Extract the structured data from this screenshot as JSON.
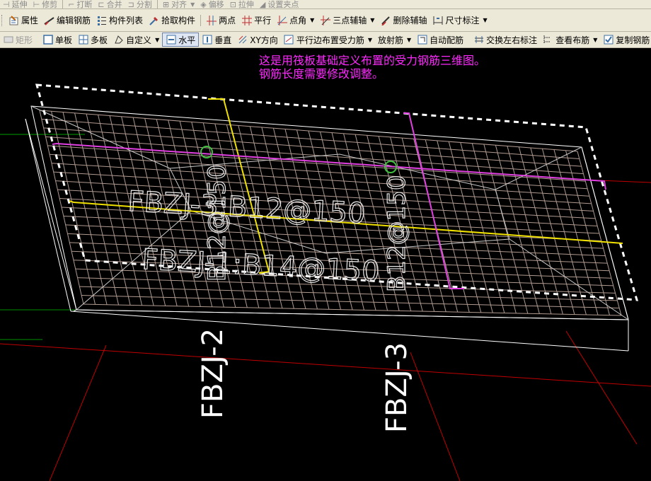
{
  "toolbar_top": {
    "items": [
      "延伸",
      "修剪",
      "打断",
      "合并",
      "分割",
      "对齐",
      "偏移",
      "拉伸",
      "设置夹点"
    ]
  },
  "toolbar1": {
    "properties": "属性",
    "edit_rebar": "编辑钢筋",
    "component_list": "构件列表",
    "pick_component": "拾取构件",
    "two_points": "两点",
    "parallel": "平行",
    "point_angle": "点角",
    "three_point_aux": "三点辅轴",
    "delete_aux": "删除辅轴",
    "dimension": "尺寸标注"
  },
  "toolbar2": {
    "rectangle": "矩形",
    "single_slab": "单板",
    "multi_slab": "多板",
    "custom": "自定义",
    "horizontal": "水平",
    "vertical": "垂直",
    "xy_direction": "XY方向",
    "parallel_edge_rebar": "平行边布置受力筋",
    "radial_rebar": "放射筋",
    "auto_rebar": "自动配筋",
    "swap_labels": "交换左右标注",
    "view_rebar": "查看布筋",
    "copy_rebar": "复制钢筋"
  },
  "viewport": {
    "annotation_line1": "这是用筏板基础定义布置的受力钢筋三维图。",
    "annotation_line2": "钢筋长度需要修改调整。",
    "labels": {
      "fbzj3_top": "FBZJ-3:B12@150",
      "fbzj1": "FBZJ-1:B14@150",
      "fbzj2_vertical": "FBZJ-2",
      "fbzj3_vertical": "FBZJ-3",
      "fbzj2_mid": "B12@150",
      "fbzj3_mid": "B12@150"
    }
  },
  "colors": {
    "toolbar_bg": "#ece9d8",
    "canvas_bg": "#000000",
    "annotation": "#ff28ff",
    "mesh": "#b09a90",
    "slab_outline": "#ffffff",
    "rebar_yellow": "#f0e000",
    "rebar_magenta": "#e040e0",
    "axis_red": "#c00000",
    "axis_green": "#00a000"
  }
}
